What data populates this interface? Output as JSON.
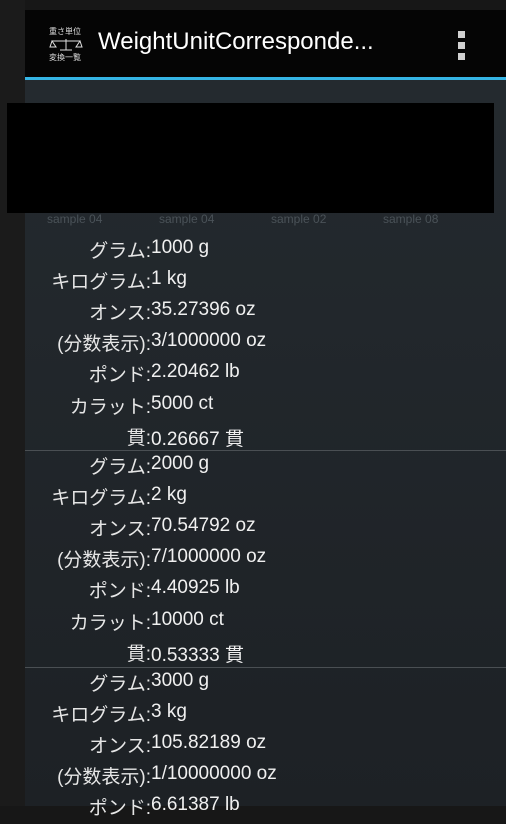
{
  "app": {
    "title": "WeightUnitCorresponde...",
    "icon_text_top": "重さ単位",
    "icon_text_bottom": "変換一覧",
    "accent_color": "#35b5e5"
  },
  "tabs": [
    "sample 04",
    "sample 04",
    "sample 02",
    "sample 08"
  ],
  "records": [
    {
      "rows": [
        {
          "label": "グラム:",
          "value": "1000 g"
        },
        {
          "label": "キログラム:",
          "value": "1 kg"
        },
        {
          "label": "オンス:",
          "value": "35.27396 oz"
        },
        {
          "label": "(分数表示):",
          "value": "3/1000000 oz"
        },
        {
          "label": "ポンド:",
          "value": "2.20462 lb"
        },
        {
          "label": "カラット:",
          "value": "5000 ct"
        },
        {
          "label": "貫:",
          "value": "0.26667 貫"
        }
      ]
    },
    {
      "rows": [
        {
          "label": "グラム:",
          "value": "2000 g"
        },
        {
          "label": "キログラム:",
          "value": "2 kg"
        },
        {
          "label": "オンス:",
          "value": "70.54792 oz"
        },
        {
          "label": "(分数表示):",
          "value": "7/1000000 oz"
        },
        {
          "label": "ポンド:",
          "value": "4.40925 lb"
        },
        {
          "label": "カラット:",
          "value": "10000 ct"
        },
        {
          "label": "貫:",
          "value": "0.53333 貫"
        }
      ]
    },
    {
      "rows": [
        {
          "label": "グラム:",
          "value": "3000 g"
        },
        {
          "label": "キログラム:",
          "value": "3 kg"
        },
        {
          "label": "オンス:",
          "value": "105.82189 oz"
        },
        {
          "label": "(分数表示):",
          "value": "1/10000000 oz"
        },
        {
          "label": "ポンド:",
          "value": "6.61387 lb"
        }
      ]
    }
  ]
}
